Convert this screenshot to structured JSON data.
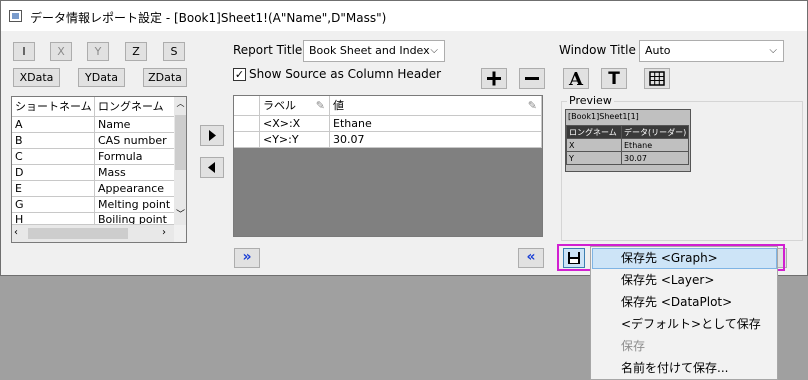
{
  "window": {
    "title": "データ情報レポート設定 - [Book1]Sheet1!(A\"Name\",D\"Mass\")"
  },
  "axis_buttons": {
    "i": "I",
    "x": "X",
    "y": "Y",
    "z": "Z",
    "s": "S",
    "xdata": "XData",
    "ydata": "YData",
    "zdata": "ZData"
  },
  "name_list": {
    "headers": [
      "ショートネーム",
      "ロングネーム"
    ],
    "rows": [
      {
        "short": "A",
        "long": "Name"
      },
      {
        "short": "B",
        "long": "CAS number"
      },
      {
        "short": "C",
        "long": "Formula"
      },
      {
        "short": "D",
        "long": "Mass"
      },
      {
        "short": "E",
        "long": "Appearance"
      },
      {
        "short": "G",
        "long": "Melting point"
      },
      {
        "short": "H",
        "long": "Boiling point"
      }
    ]
  },
  "report_title": {
    "label": "Report Title",
    "value": "Book Sheet and Index"
  },
  "show_source": {
    "label": "Show Source as Column Header",
    "checked": true
  },
  "report_grid": {
    "headers": [
      "ラベル",
      "値"
    ],
    "rows": [
      {
        "label": "<X>:X",
        "value": "Ethane"
      },
      {
        "label": "<Y>:Y",
        "value": "30.07"
      }
    ]
  },
  "window_title": {
    "label": "Window Title",
    "value": "Auto"
  },
  "preview": {
    "label": "Preview",
    "caption": "[Book1]Sheet1[1]",
    "headers": [
      "ロングネーム",
      "データ(リーダー)"
    ],
    "rows": [
      [
        "X",
        "Ethane"
      ],
      [
        "Y",
        "30.07"
      ]
    ]
  },
  "save_menu": {
    "items": [
      {
        "label": "保存先 <Graph>",
        "enabled": true,
        "highlighted": true
      },
      {
        "label": "保存先 <Layer>",
        "enabled": true
      },
      {
        "label": "保存先 <DataPlot>",
        "enabled": true
      },
      {
        "label": "<デフォルト>として保存",
        "enabled": true
      },
      {
        "label": "保存",
        "enabled": false
      },
      {
        "label": "名前を付けて保存...",
        "enabled": true
      }
    ]
  },
  "colors": {
    "highlight_frame": "#d11fd1",
    "menu_highlight": "#cde4f7",
    "grid_empty": "#808080"
  }
}
